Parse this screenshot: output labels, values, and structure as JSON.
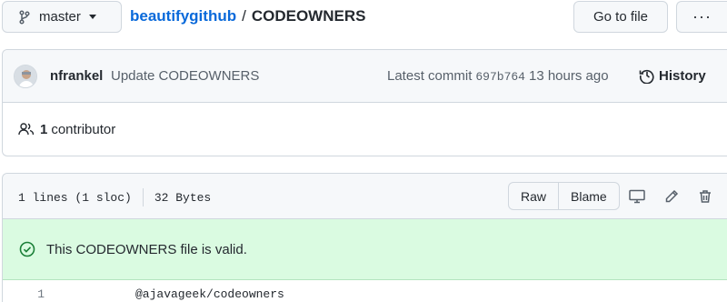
{
  "topbar": {
    "branch": "master",
    "repo": "beautifygithub",
    "separator": "/",
    "file": "CODEOWNERS",
    "goto_label": "Go to file",
    "more_label": "···"
  },
  "commit": {
    "author": "nfrankel",
    "message": "Update CODEOWNERS",
    "latest_label": "Latest commit",
    "sha": "697b764",
    "time": "13 hours ago",
    "history_label": "History"
  },
  "contributors": {
    "count": "1",
    "label": "contributor"
  },
  "file": {
    "lines": "1 lines (1 sloc)",
    "size": "32 Bytes",
    "raw_label": "Raw",
    "blame_label": "Blame",
    "valid_message": "This CODEOWNERS file is valid.",
    "code": [
      {
        "num": "1",
        "text": "@ajavageek/codeowners"
      }
    ]
  },
  "colors": {
    "link": "#0969da",
    "valid_bg": "#dafbe1",
    "valid_icon": "#1a7f37"
  },
  "icons": [
    "branch-icon",
    "history-icon",
    "people-icon",
    "desktop-icon",
    "pencil-icon",
    "trash-icon",
    "check-circle-icon"
  ]
}
